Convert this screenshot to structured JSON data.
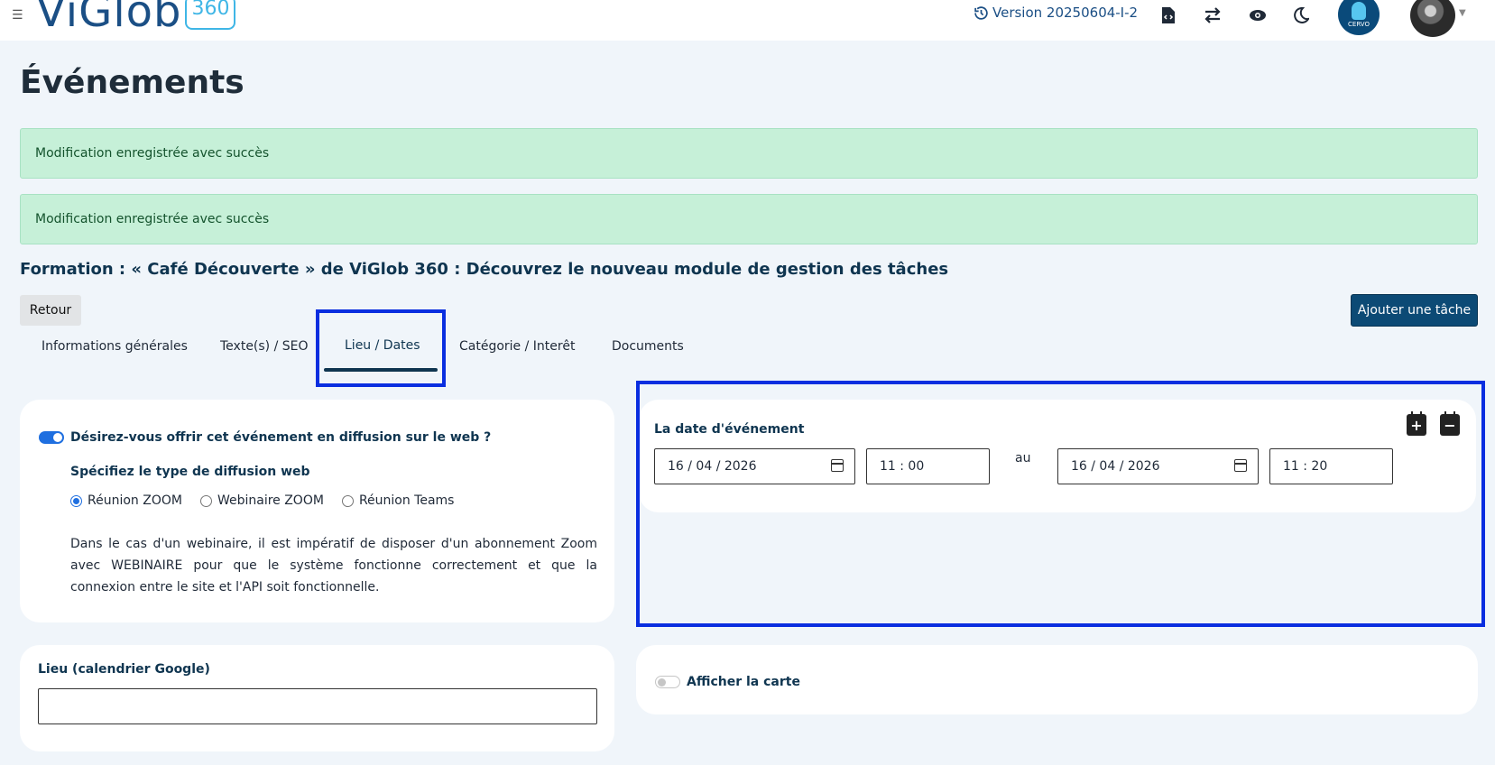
{
  "topbar": {
    "logo_text": "ViGlob",
    "logo_badge": "360",
    "version": "Version 20250604-I-2",
    "cervo_label": "CERVO"
  },
  "page": {
    "title": "Événements"
  },
  "alerts": [
    "Modification enregistrée avec succès",
    "Modification enregistrée avec succès"
  ],
  "event": {
    "title": "Formation : « Café Découverte » de ViGlob 360 : Découvrez le nouveau module de gestion des tâches"
  },
  "buttons": {
    "back": "Retour",
    "add_task": "Ajouter une tâche"
  },
  "tabs": [
    {
      "label": "Informations générales",
      "active": false
    },
    {
      "label": "Texte(s) / SEO",
      "active": false
    },
    {
      "label": "Lieu / Dates",
      "active": true
    },
    {
      "label": "Catégorie / Interêt",
      "active": false
    },
    {
      "label": "Documents",
      "active": false
    }
  ],
  "web": {
    "toggle_label": "Désirez-vous offrir cet événement en diffusion sur le web ?",
    "toggle_on": true,
    "type_label": "Spécifiez le type de diffusion web",
    "options": [
      {
        "label": "Réunion ZOOM",
        "checked": true
      },
      {
        "label": "Webinaire ZOOM",
        "checked": false
      },
      {
        "label": "Réunion Teams",
        "checked": false
      }
    ],
    "note": "Dans le cas d'un webinaire, il est impératif de disposer d'un abonnement Zoom avec WEBINAIRE pour que le système fonctionne correctement et que la connexion entre le site et l'API soit fonctionnelle."
  },
  "lieu": {
    "label": "Lieu (calendrier Google)",
    "value": ""
  },
  "dates": {
    "label": "La date d'événement",
    "start_date": "16 / 04 / 2026",
    "start_time": "11 : 00",
    "separator": "au",
    "end_date": "16 / 04 / 2026",
    "end_time": "11 : 20"
  },
  "map": {
    "toggle_label": "Afficher la carte",
    "toggle_on": false
  },
  "icons": {
    "history": "history-icon",
    "file-code": "file-code-icon",
    "swap": "swap-icon",
    "eye": "eye-icon",
    "moon": "moon-icon",
    "calendar-plus": "calendar-plus-icon",
    "calendar-minus": "calendar-minus-icon"
  },
  "colors": {
    "primary": "#0c4a75",
    "alert_bg": "#c6f0d8",
    "highlight": "#0a2ee0",
    "toggle_on": "#1f6fe0"
  }
}
